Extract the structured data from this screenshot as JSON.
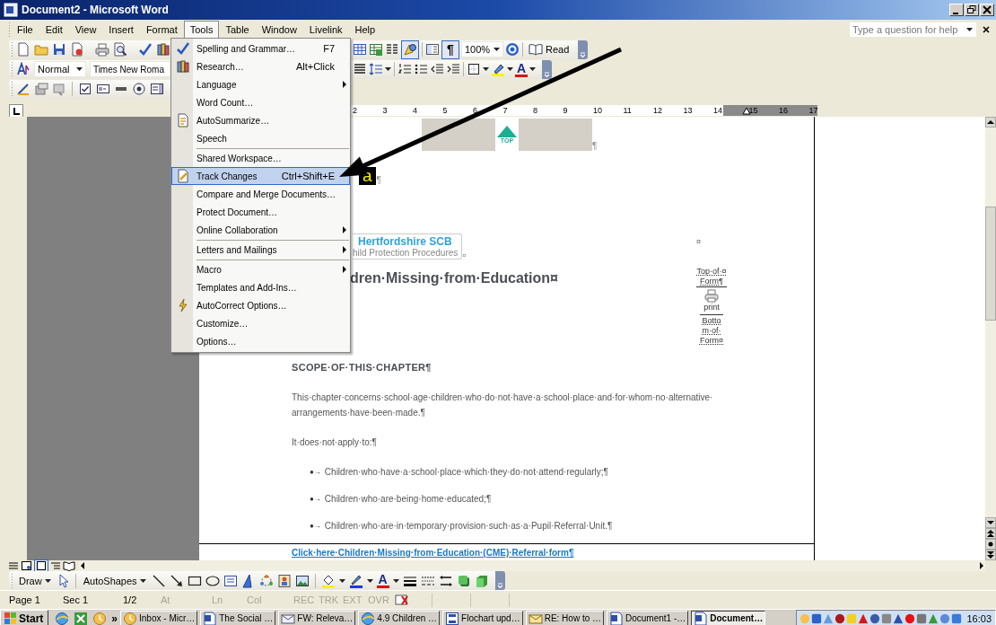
{
  "window": {
    "title": "Document2 - Microsoft Word"
  },
  "menu_bar": [
    {
      "label": "File",
      "selected": false
    },
    {
      "label": "Edit",
      "selected": false
    },
    {
      "label": "View",
      "selected": false
    },
    {
      "label": "Insert",
      "selected": false
    },
    {
      "label": "Format",
      "selected": false
    },
    {
      "label": "Tools",
      "selected": true
    },
    {
      "label": "Table",
      "selected": false
    },
    {
      "label": "Window",
      "selected": false
    },
    {
      "label": "Livelink",
      "selected": false
    },
    {
      "label": "Help",
      "selected": false
    }
  ],
  "help_box": {
    "placeholder": "Type a question for help"
  },
  "standard_toolbar": {
    "drawing_selected": true,
    "formatting_marks": {
      "label": "¶",
      "selected": true
    },
    "zoom": "100%",
    "read_label": "Read"
  },
  "formatting_toolbar": {
    "style": "Normal",
    "font": "Times New Roma",
    "font_color_glyph": "A"
  },
  "tools_menu": [
    {
      "label": "Spelling and Grammar…",
      "shortcut": "F7",
      "submenu": false,
      "separator_before": false,
      "selected": false
    },
    {
      "label": "Research…",
      "shortcut": "Alt+Click",
      "submenu": false,
      "separator_before": false,
      "selected": false
    },
    {
      "label": "Language",
      "submenu": true,
      "separator_before": false,
      "selected": false
    },
    {
      "label": "Word Count…",
      "submenu": false,
      "separator_before": false,
      "selected": false
    },
    {
      "label": "AutoSummarize…",
      "submenu": false,
      "separator_before": false,
      "selected": false
    },
    {
      "label": "Speech",
      "submenu": false,
      "separator_before": false,
      "selected": false
    },
    {
      "label": "Shared Workspace…",
      "submenu": false,
      "separator_before": true,
      "selected": false
    },
    {
      "label": "Track Changes",
      "shortcut": "Ctrl+Shift+E",
      "submenu": false,
      "separator_before": false,
      "selected": true
    },
    {
      "label": "Compare and Merge Documents…",
      "submenu": false,
      "separator_before": false,
      "selected": false
    },
    {
      "label": "Protect Document…",
      "submenu": false,
      "separator_before": false,
      "selected": false
    },
    {
      "label": "Online Collaboration",
      "submenu": true,
      "separator_before": false,
      "selected": false
    },
    {
      "label": "Letters and Mailings",
      "submenu": true,
      "separator_before": true,
      "selected": false
    },
    {
      "label": "Macro",
      "submenu": true,
      "separator_before": true,
      "selected": false
    },
    {
      "label": "Templates and Add-Ins…",
      "submenu": false,
      "separator_before": false,
      "selected": false
    },
    {
      "label": "AutoCorrect Options…",
      "submenu": false,
      "separator_before": false,
      "selected": false
    },
    {
      "label": "Customize…",
      "submenu": false,
      "separator_before": false,
      "selected": false
    },
    {
      "label": "Options…",
      "submenu": false,
      "separator_before": false,
      "selected": false
    }
  ],
  "ruler": {
    "numbers": [
      "2",
      "3",
      "4",
      "5",
      "6",
      "7",
      "8",
      "9",
      "10",
      "11",
      "12",
      "13",
      "14",
      "15",
      "16",
      "17"
    ]
  },
  "document": {
    "top_label": "TOP",
    "banner_mark": "¶",
    "badge": "a",
    "badge_mark": "¶",
    "logo_title": "Hertfordshire SCB",
    "logo_subtitle": "hild Protection Procedures",
    "logo_mark": "¤",
    "cell_mark": "¤",
    "heading": "dren·Missing·from·Education¤",
    "form_top": [
      "Top·of·¤",
      "Form¶"
    ],
    "print_label": "print",
    "form_bottom": [
      "Botto",
      "m·of·",
      "Form¤"
    ],
    "section_heading": "SCOPE·OF·THIS·CHAPTER¶",
    "paragraphs": [
      "This·chapter·concerns·school·age·children·who·do·not·have·a·school·place·and·for·whom·no·alternative·arrangements·have·been·made.¶",
      "It·does·not·apply·to:¶"
    ],
    "bullets": [
      {
        "marker": "●→",
        "text": "Children·who·have·a·school·place·which·they·do·not·attend·regularly;¶"
      },
      {
        "marker": "●→",
        "text": "Children·who·are·being·home·educated;¶"
      },
      {
        "marker": "●→",
        "text": "Children·who·are·in·temporary·provision·such·as·a·Pupil·Referral·Unit.¶"
      }
    ],
    "link": "Click·here·Children·Missing·from·Education·(CME)·Referral·form¶"
  },
  "draw_toolbar": {
    "draw_label": "Draw",
    "autoshapes_label": "AutoShapes",
    "font_color_glyph": "A"
  },
  "status_bar": [
    {
      "label": "Page 1",
      "disabled": false
    },
    {
      "label": "Sec 1",
      "disabled": false
    },
    {
      "label": "1/2",
      "disabled": false
    },
    {
      "label": "At",
      "disabled": true
    },
    {
      "label": "Ln",
      "disabled": true
    },
    {
      "label": "Col",
      "disabled": true
    },
    {
      "label": "REC",
      "disabled": true
    },
    {
      "label": "TRK",
      "disabled": true
    },
    {
      "label": "EXT",
      "disabled": true
    },
    {
      "label": "OVR",
      "disabled": true
    }
  ],
  "taskbar": {
    "start_label": "Start",
    "more": "»",
    "clock": "16:03",
    "tasks": [
      {
        "label": "Inbox - Micr…",
        "selected": false
      },
      {
        "label": "The Social …",
        "selected": false
      },
      {
        "label": "FW: Releva…",
        "selected": false
      },
      {
        "label": "4.9 Children …",
        "selected": false
      },
      {
        "label": "Flochart upd…",
        "selected": false
      },
      {
        "label": "RE: How to …",
        "selected": false
      },
      {
        "label": "Document1 -…",
        "selected": false
      },
      {
        "label": "Document…",
        "selected": true
      }
    ]
  }
}
